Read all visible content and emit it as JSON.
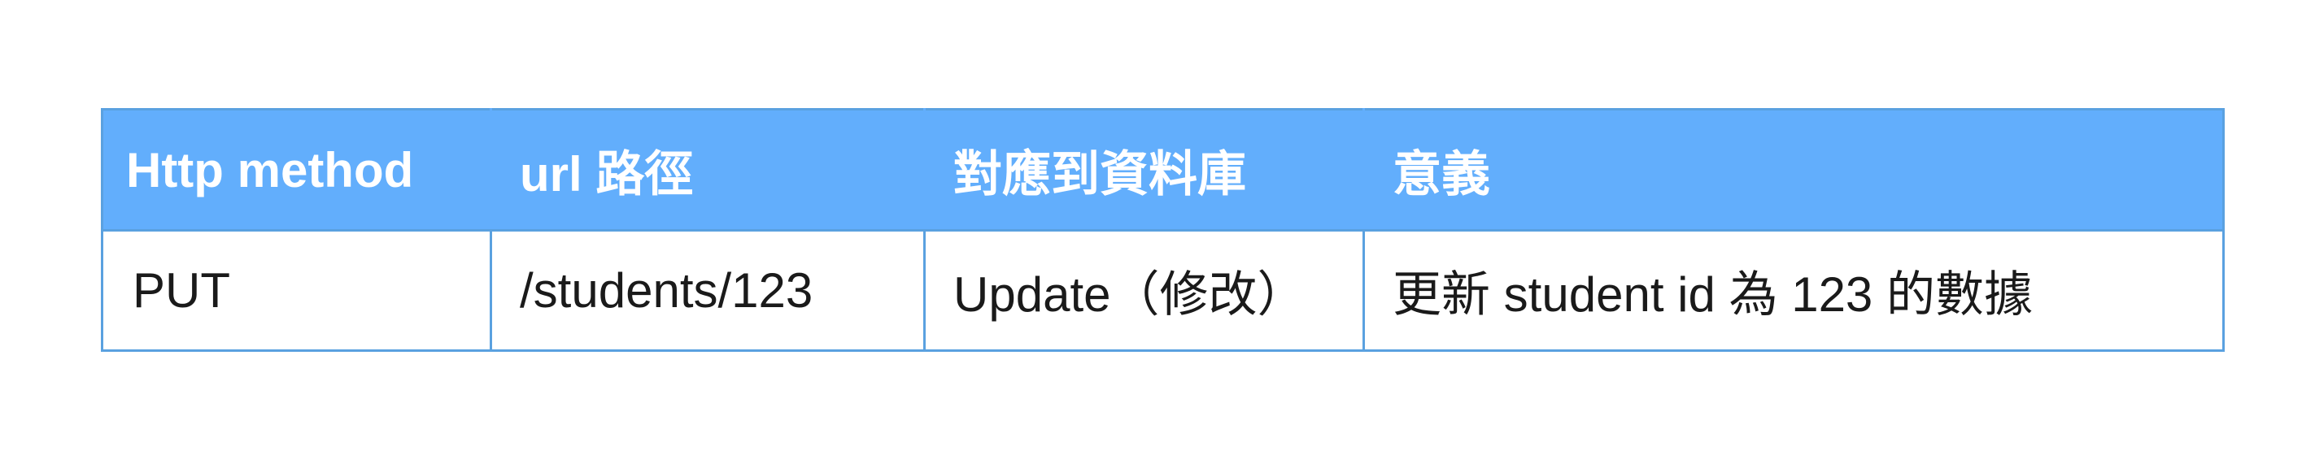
{
  "table": {
    "headers": [
      "Http method",
      "url 路徑",
      "對應到資料庫",
      "意義"
    ],
    "rows": [
      [
        "PUT",
        "/students/123",
        "Update（修改）",
        "更新 student id 為 123 的數據"
      ]
    ]
  },
  "colors": {
    "header_background": "#62aefc",
    "header_text": "#ffffff",
    "border": "#5aa1e0",
    "body_text": "#1a1a1a"
  }
}
